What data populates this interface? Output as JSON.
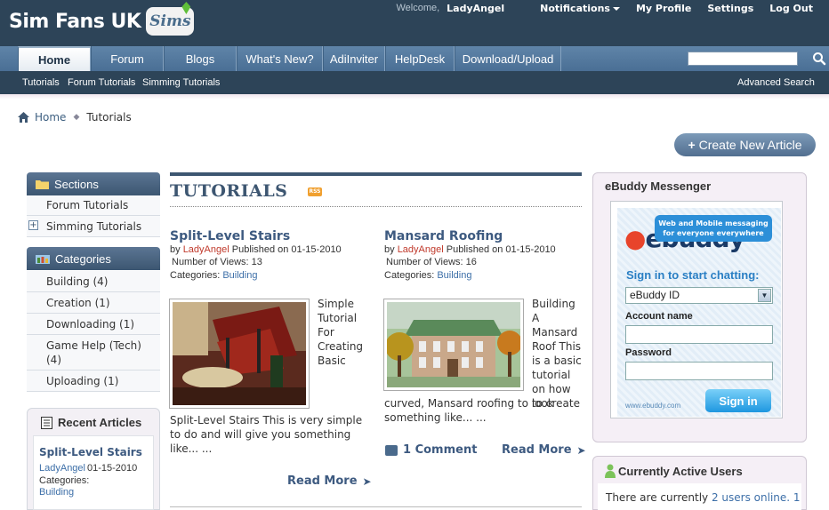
{
  "header": {
    "logo_text": "Sim Fans UK",
    "logo_badge": "Sims",
    "welcome": "Welcome,",
    "username": "LadyAngel",
    "links": [
      "Notifications",
      "My Profile",
      "Settings",
      "Log Out"
    ]
  },
  "nav": {
    "tabs": [
      "Home",
      "Forum",
      "Blogs",
      "What's New?",
      "AdiInviter",
      "HelpDesk",
      "Download/Upload"
    ],
    "active": "Home"
  },
  "subnav": {
    "links": [
      "Tutorials",
      "Forum Tutorials",
      "Simming Tutorials"
    ],
    "advanced_search": "Advanced Search"
  },
  "breadcrumb": {
    "home": "Home",
    "current": "Tutorials"
  },
  "create_button": "Create New Article",
  "sections": {
    "title": "Sections",
    "items": [
      "Forum Tutorials",
      "Simming Tutorials"
    ]
  },
  "categories": {
    "title": "Categories",
    "items": [
      "Building (4)",
      "Creation (1)",
      "Downloading (1)",
      "Game Help (Tech) (4)",
      "Uploading (1)"
    ]
  },
  "recent": {
    "title": "Recent Articles",
    "article_title": "Split-Level Stairs",
    "author": "LadyAngel",
    "date": "01-15-2010",
    "categories_label": "Categories:",
    "category": "Building"
  },
  "main": {
    "title": "TUTORIALS",
    "rss": "RSS",
    "articles": [
      {
        "title": "Split-Level Stairs",
        "by": "by",
        "author": "LadyAngel",
        "published": "Published on 01-15-2010",
        "views": "Number of Views: 13",
        "categories_label": "Categories:",
        "category": "Building",
        "side_text": "Simple Tutorial For Creating Basic",
        "body": "Split-Level Stairs This is very simple to do and will give you something like... ...",
        "read_more": "Read More"
      },
      {
        "title": "Mansard Roofing",
        "by": "by",
        "author": "LadyAngel",
        "published": "Published on 01-15-2010",
        "views": "Number of Views: 16",
        "categories_label": "Categories:",
        "category": "Building",
        "side_text": "Building A Mansard Roof This is a basic tutorial on how to create",
        "body": "curved, Mansard roofing to look something like... ...",
        "comments": "1 Comment",
        "read_more": "Read More"
      }
    ]
  },
  "ebuddy": {
    "title": "eBuddy Messenger",
    "logo": "ebuddy",
    "bubble": "Web and Mobile messaging for everyone everywhere",
    "signin_title": "Sign in to start chatting:",
    "select_value": "eBuddy ID",
    "account_label": "Account name",
    "password_label": "Password",
    "footer": "www.ebuddy.com",
    "button": "Sign in"
  },
  "active_users": {
    "title": "Currently Active Users",
    "text_prefix": "There are currently",
    "link": "2 users online.",
    "count": "1"
  }
}
